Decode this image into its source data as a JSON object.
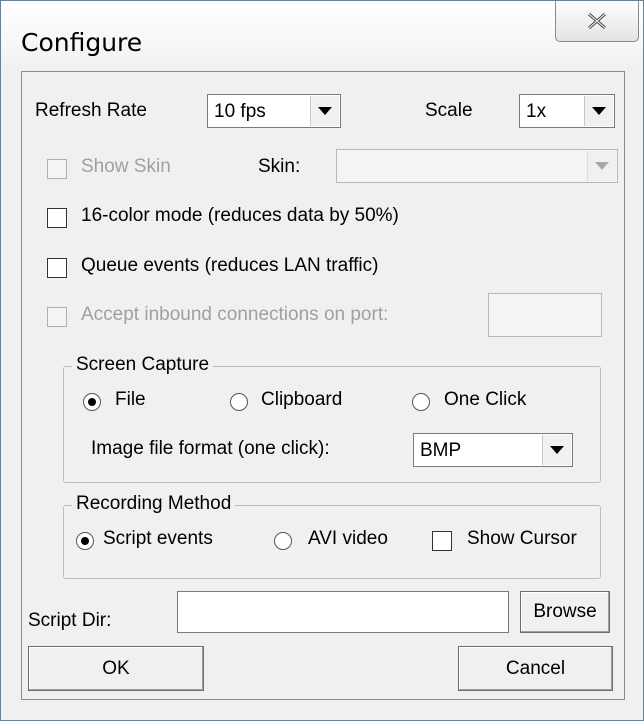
{
  "window": {
    "title": "Configure"
  },
  "refresh": {
    "label": "Refresh Rate",
    "value": "10 fps"
  },
  "scale": {
    "label": "Scale",
    "value": "1x"
  },
  "show_skin": {
    "label": "Show Skin",
    "checked": false
  },
  "skin": {
    "label": "Skin:",
    "value": ""
  },
  "options": {
    "color16": "16-color mode (reduces data by 50%)",
    "queue_events": "Queue events (reduces LAN traffic)",
    "accept_inbound": "Accept inbound connections on port:"
  },
  "screen_capture": {
    "title": "Screen Capture",
    "file": "File",
    "clipboard": "Clipboard",
    "one_click": "One Click",
    "selected": "File",
    "format_label": "Image file format (one click):",
    "format_value": "BMP"
  },
  "recording": {
    "title": "Recording Method",
    "script_events": "Script events",
    "avi_video": "AVI video",
    "show_cursor": "Show Cursor",
    "selected": "Script events"
  },
  "script_dir": {
    "label": "Script Dir:",
    "value": "",
    "browse": "Browse"
  },
  "buttons": {
    "ok": "OK",
    "cancel": "Cancel"
  },
  "icons": {
    "close": "close-x-icon",
    "dropdown": "dropdown-arrow-icon"
  }
}
